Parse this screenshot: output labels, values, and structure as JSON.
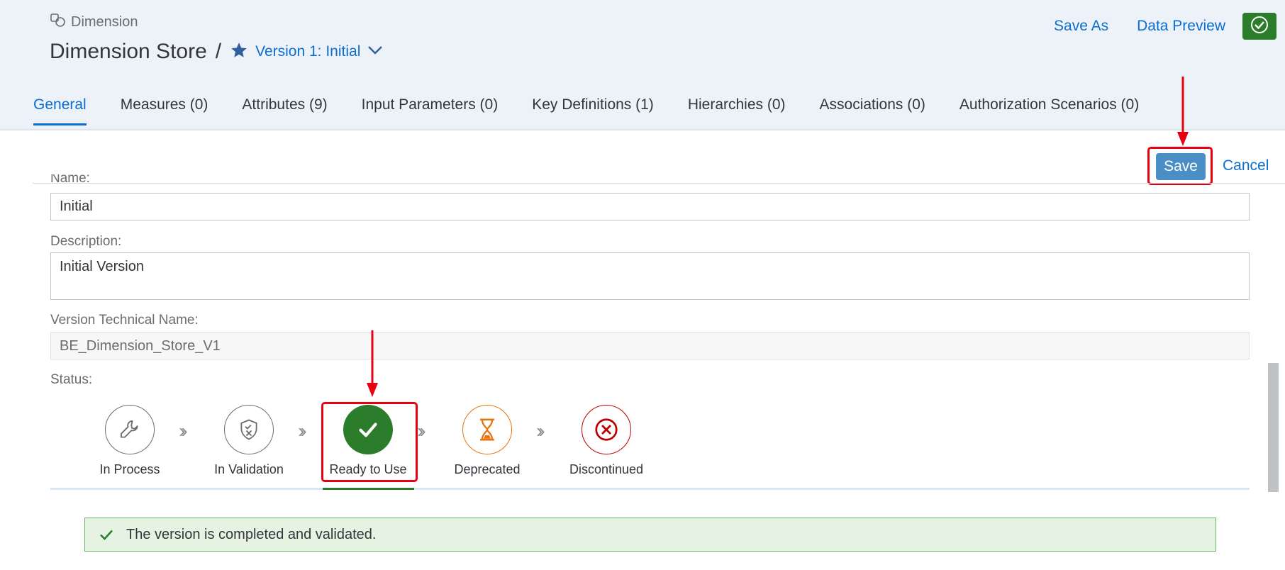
{
  "breadcrumb": {
    "text": "Dimension"
  },
  "header": {
    "title": "Dimension Store",
    "separator": "/",
    "version_label": "Version 1: Initial"
  },
  "actions": {
    "save_as": "Save As",
    "data_preview": "Data Preview"
  },
  "tabs": [
    {
      "label": "General"
    },
    {
      "label": "Measures (0)"
    },
    {
      "label": "Attributes (9)"
    },
    {
      "label": "Input Parameters (0)"
    },
    {
      "label": "Key Definitions (1)"
    },
    {
      "label": "Hierarchies (0)"
    },
    {
      "label": "Associations (0)"
    },
    {
      "label": "Authorization Scenarios (0)"
    }
  ],
  "edit_actions": {
    "save": "Save",
    "cancel": "Cancel"
  },
  "form": {
    "name_label": "Name:",
    "name_value": "Initial",
    "description_label": "Description:",
    "description_value": "Initial Version",
    "tech_name_label": "Version Technical Name:",
    "tech_name_value": "BE_Dimension_Store_V1",
    "status_label": "Status:"
  },
  "status_steps": [
    {
      "label": "In Process",
      "icon": "wrench-icon"
    },
    {
      "label": "In Validation",
      "icon": "shield-x-icon"
    },
    {
      "label": "Ready to Use",
      "icon": "checkmark-icon",
      "selected": true
    },
    {
      "label": "Deprecated",
      "icon": "hourglass-icon"
    },
    {
      "label": "Discontinued",
      "icon": "circle-x-icon"
    }
  ],
  "message": {
    "text": "The version is completed and validated."
  },
  "colors": {
    "accent": "#0a6ed1",
    "success": "#2b7d2b",
    "warning": "#e9730c",
    "error": "#bb0000",
    "highlight": "#e8000f"
  }
}
